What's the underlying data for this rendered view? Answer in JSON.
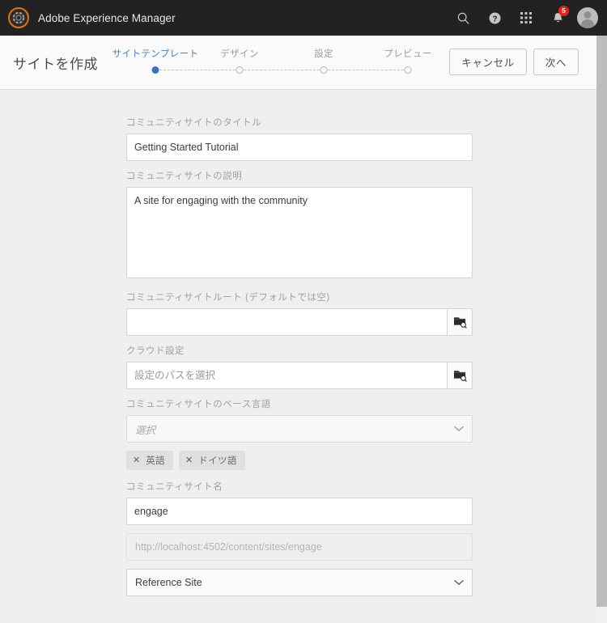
{
  "colors": {
    "rail_bg": "#222222",
    "brand_accent": "#e8730a",
    "wizard_active": "#4a7ec8",
    "badge": "#e1251b",
    "content_bg": "#efefef"
  },
  "top_rail": {
    "logo_icon": "adobe-experience-manager-logo",
    "title": "Adobe Experience Manager",
    "icons": [
      {
        "name": "search-icon",
        "label": "検索"
      },
      {
        "name": "help-icon",
        "label": "ヘルプ"
      },
      {
        "name": "solutions-grid-icon",
        "label": "ソリューション"
      },
      {
        "name": "notifications-bell-icon",
        "label": "通知",
        "badge": "5"
      }
    ],
    "avatar_label": "ユーザー"
  },
  "header": {
    "page_title": "サイトを作成",
    "cancel_label": "キャンセル",
    "next_label": "次へ",
    "steps": [
      {
        "label": "サイトテンプレート",
        "state": "active"
      },
      {
        "label": "デザイン",
        "state": "inactive"
      },
      {
        "label": "設定",
        "state": "inactive"
      },
      {
        "label": "プレビュー",
        "state": "inactive"
      }
    ]
  },
  "form": {
    "title": {
      "label": "コミュニティサイトのタイトル",
      "value": "Getting Started Tutorial",
      "placeholder": ""
    },
    "description": {
      "label": "コミュニティサイトの説明",
      "value": "A site for engaging with the community",
      "placeholder": ""
    },
    "root": {
      "label": "コミュニティサイトルート (デフォルトでは空)",
      "value": "",
      "placeholder": "",
      "picker_icon": "folder-search-icon"
    },
    "cloud_config": {
      "label": "クラウド設定",
      "value": "",
      "placeholder": "設定のパスを選択",
      "picker_icon": "folder-search-icon"
    },
    "base_language": {
      "label": "コミュニティサイトのベース言語",
      "value": "",
      "placeholder": "選択",
      "chevron_icon": "chevron-down-icon"
    },
    "language_tags": [
      {
        "label": "英語",
        "remove_icon": "close-icon"
      },
      {
        "label": "ドイツ語",
        "remove_icon": "close-icon"
      }
    ],
    "site_name": {
      "label": "コミュニティサイト名",
      "value": "engage",
      "placeholder": ""
    },
    "site_url": {
      "value": "http://localhost:4502/content/sites/engage"
    },
    "template_select": {
      "value": "Reference Site",
      "chevron_icon": "chevron-down-icon"
    }
  }
}
